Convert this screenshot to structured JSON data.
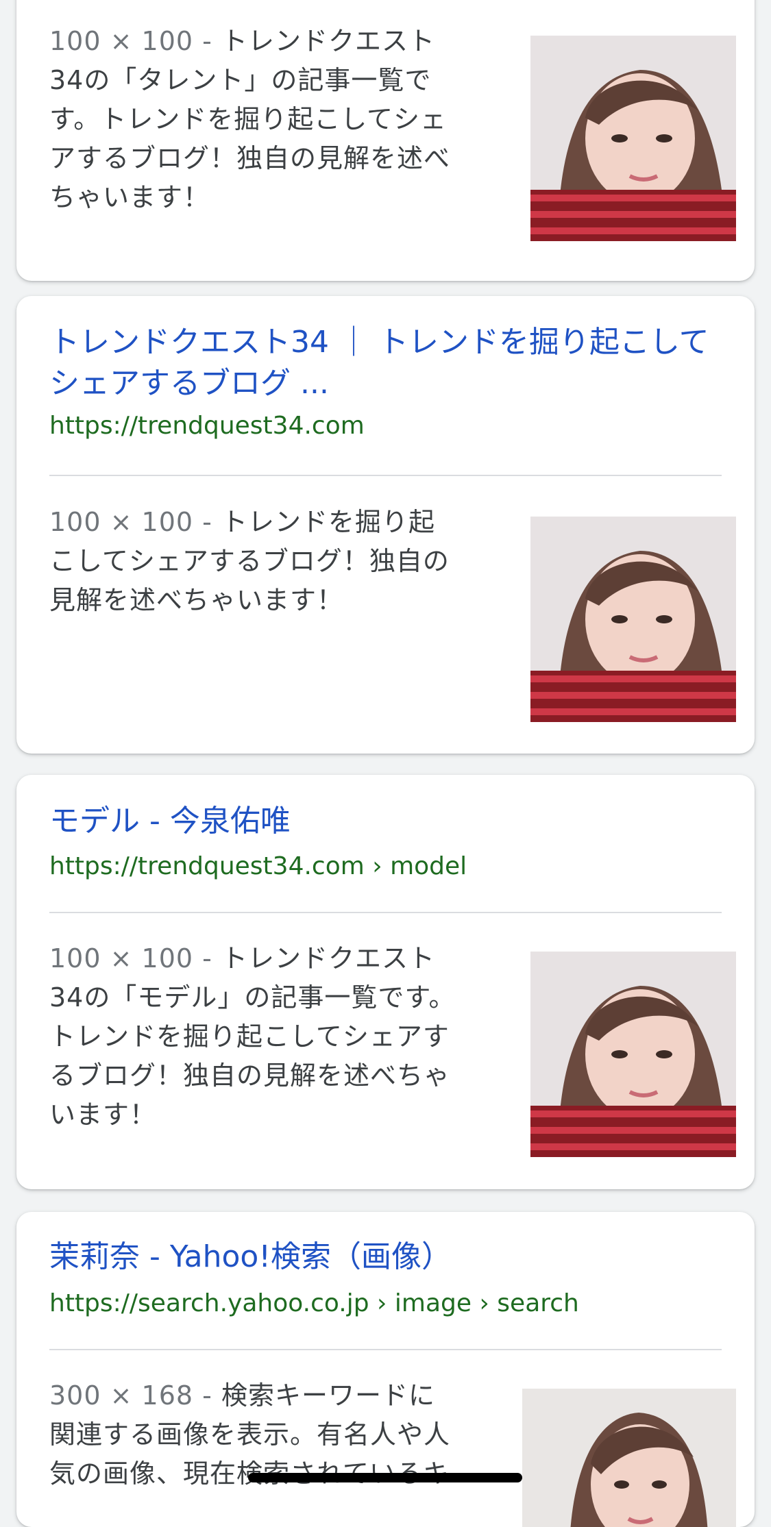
{
  "results": [
    {
      "title": "",
      "url": "",
      "meta": "100 × 100 -",
      "description": "トレンドクエスト34の「タレント」の記事一覧です。トレンドを掘り起こしてシェアするブログ！独自の見解を述べちゃいます！",
      "thumb_icon": "portrait-thumbnail"
    },
    {
      "title": "トレンドクエスト34 ｜ トレンドを掘り起こしてシェアするブログ ...",
      "url": "https://trendquest34.com",
      "meta": "100 × 100 -",
      "description": "トレンドを掘り起こしてシェアするブログ！独自の見解を述べちゃいます！",
      "thumb_icon": "portrait-thumbnail"
    },
    {
      "title": "モデル - 今泉佑唯",
      "url": "https://trendquest34.com › model",
      "meta": "100 × 100 -",
      "description": "トレンドクエスト34の「モデル」の記事一覧です。トレンドを掘り起こしてシェアするブログ！独自の見解を述べちゃいます！",
      "thumb_icon": "portrait-thumbnail"
    },
    {
      "title": "茉莉奈 - Yahoo!検索（画像）",
      "url": "https://search.yahoo.co.jp › image › search",
      "meta": "300 × 168 -",
      "description": "検索キーワードに関連する画像を表示。有名人や人気の画像、現在検索されているキ",
      "thumb_icon": "portrait-thumbnail"
    }
  ],
  "colors": {
    "title": "#1f52c4",
    "url": "#1e6b20",
    "text": "#3c4043",
    "meta": "#70757a",
    "background": "#f1f3f4"
  }
}
